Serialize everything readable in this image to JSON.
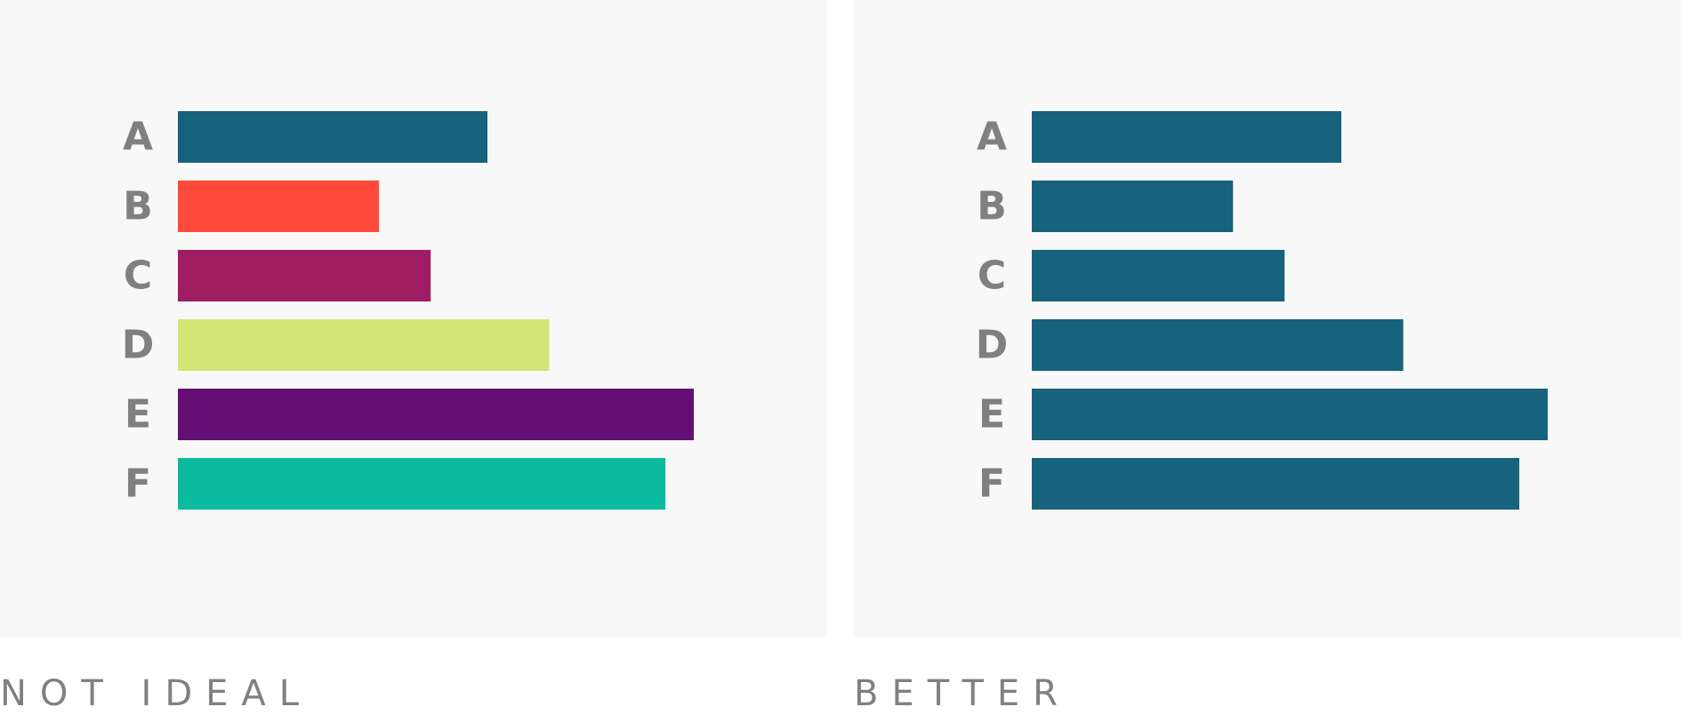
{
  "chart_data": [
    {
      "type": "bar",
      "orientation": "horizontal",
      "categories": [
        "A",
        "B",
        "C",
        "D",
        "E",
        "F"
      ],
      "values": [
        60,
        39,
        49,
        72,
        100,
        94.5
      ],
      "colors": [
        "#17627c",
        "#ff4a3b",
        "#9f1e63",
        "#d3e574",
        "#650f74",
        "#0bbba0"
      ],
      "xlim": [
        0,
        100
      ],
      "grid": false,
      "legend": "none",
      "caption": "NOT IDEAL"
    },
    {
      "type": "bar",
      "orientation": "horizontal",
      "categories": [
        "A",
        "B",
        "C",
        "D",
        "E",
        "F"
      ],
      "values": [
        60,
        39,
        49,
        72,
        100,
        94.5
      ],
      "colors": [
        "#17627c",
        "#17627c",
        "#17627c",
        "#17627c",
        "#17627c",
        "#17627c"
      ],
      "xlim": [
        0,
        100
      ],
      "grid": false,
      "legend": "none",
      "caption": "BETTER"
    }
  ],
  "style": {
    "label_color": "#808080",
    "panel_background": "#f8f8f8"
  }
}
